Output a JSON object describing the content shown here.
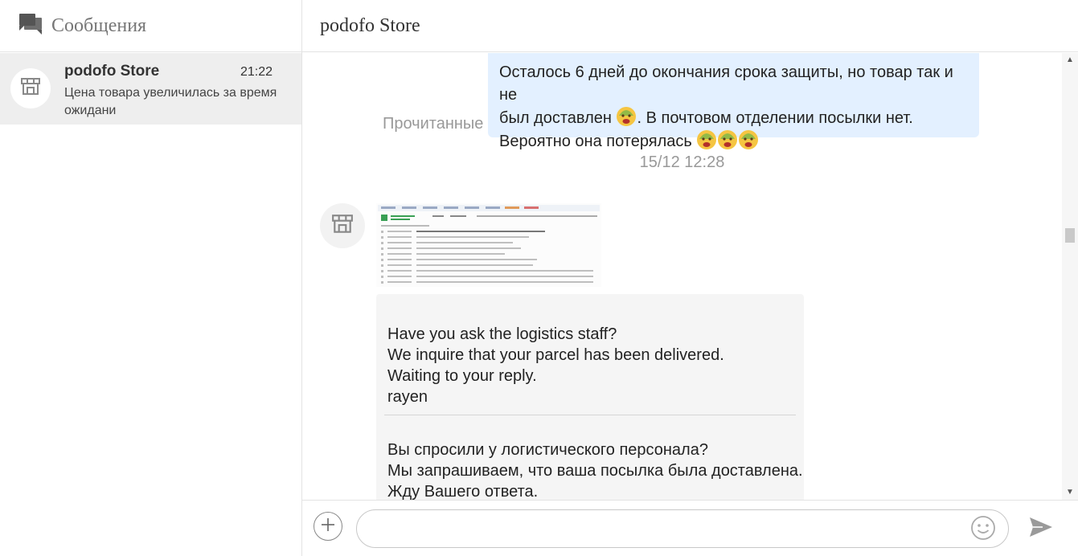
{
  "sidebar": {
    "title": "Сообщения",
    "title_icon": "chat-bubbles-icon",
    "conversation": {
      "name": "podofo Store",
      "time": "21:22",
      "preview": "Цена товара увеличилась за время ожидани",
      "avatar_icon": "store-icon"
    }
  },
  "chat": {
    "title": "podofo Store",
    "outgoing": {
      "line1": "Осталось 6 дней до окончания срока защиты, но товар так и не",
      "line2a": "был доставлен",
      "line2b": ". В почтовом отделении посылки нет.",
      "line3": "Вероятно она потерялась",
      "emoji_icon": "sad-face-emoji-icon",
      "status": "Прочитанные"
    },
    "timestamp": "15/12 12:28",
    "incoming": {
      "avatar_icon": "store-icon",
      "attachment_icon": "tracking-screenshot-image",
      "english": [
        "Have you ask the logistics staff?",
        "We inquire that your parcel has been delivered.",
        "Waiting to your reply.",
        "rayen"
      ],
      "russian": [
        "Вы спросили у логистического персонала?",
        "Мы запрашиваем, что ваша посылка была доставлена.",
        "Жду Вашего ответа."
      ]
    }
  },
  "composer": {
    "input_value": "",
    "input_placeholder": "",
    "attach_icon": "plus-icon",
    "emoji_icon": "smiley-icon",
    "send_icon": "send-icon"
  },
  "colors": {
    "outgoing_bubble": "#e3f0ff",
    "incoming_bubble": "#f5f5f5",
    "selected_conversation": "#eeeeee",
    "muted_text": "#999999"
  }
}
